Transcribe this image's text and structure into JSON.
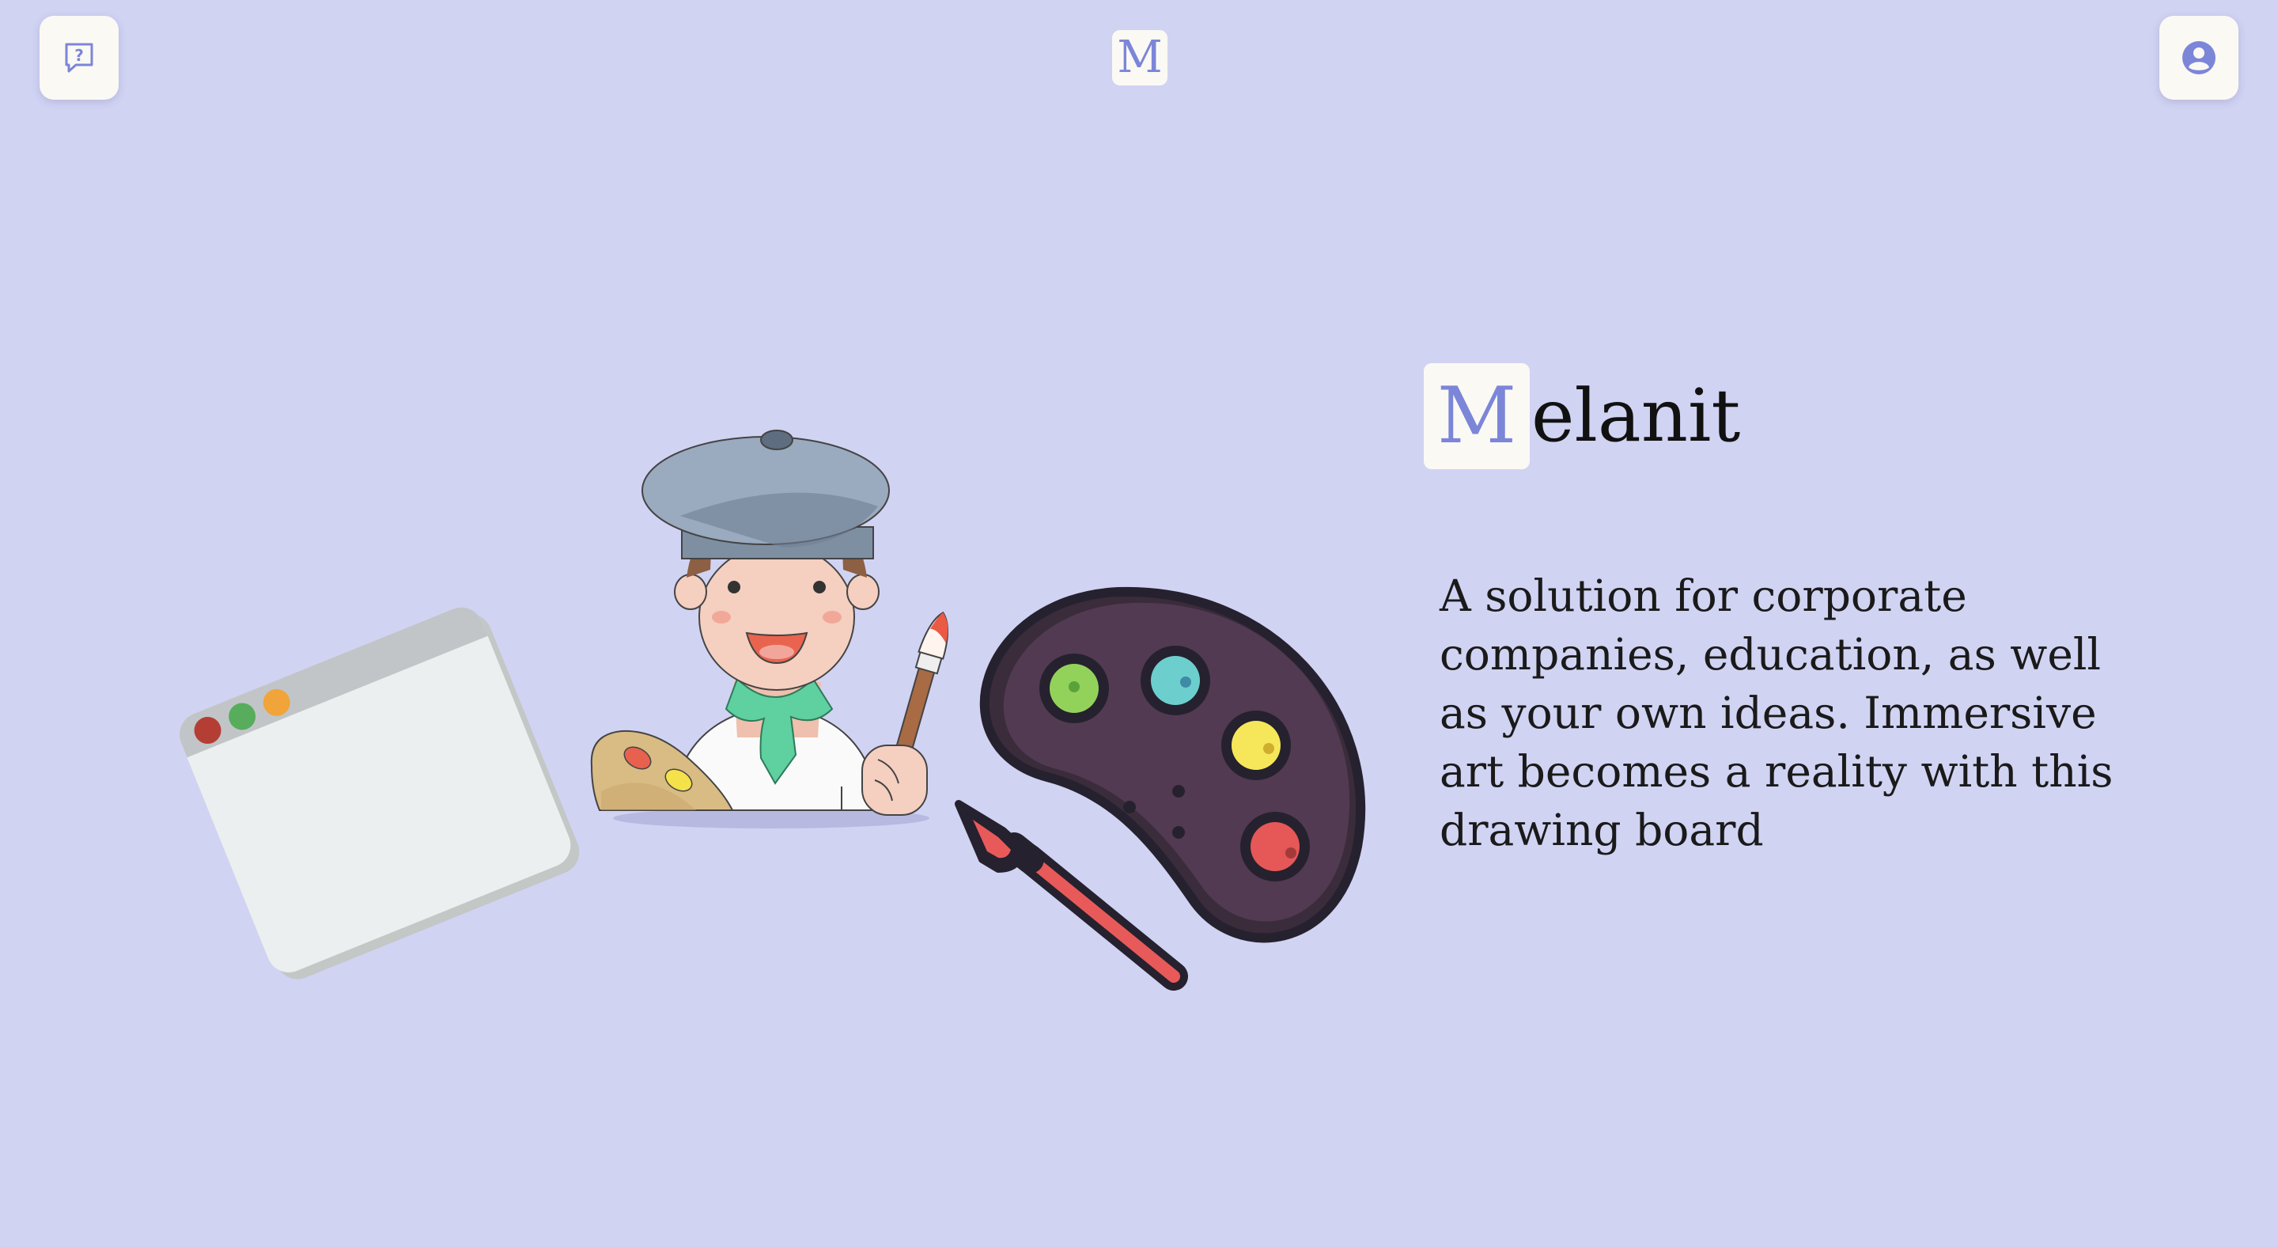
{
  "brand": {
    "logo_letter": "M",
    "title_letter": "M",
    "title_rest": "elanit",
    "accent": "#7c86d8"
  },
  "hero": {
    "description": "A solution for corporate companies, education, as well as your own ideas. Immersive art becomes a reality with this drawing board"
  },
  "toolbar": {
    "help_icon": "help-chat-icon",
    "account_icon": "account-icon"
  },
  "colors": {
    "background": "#d1d3f3",
    "card": "#fbf9f4"
  }
}
